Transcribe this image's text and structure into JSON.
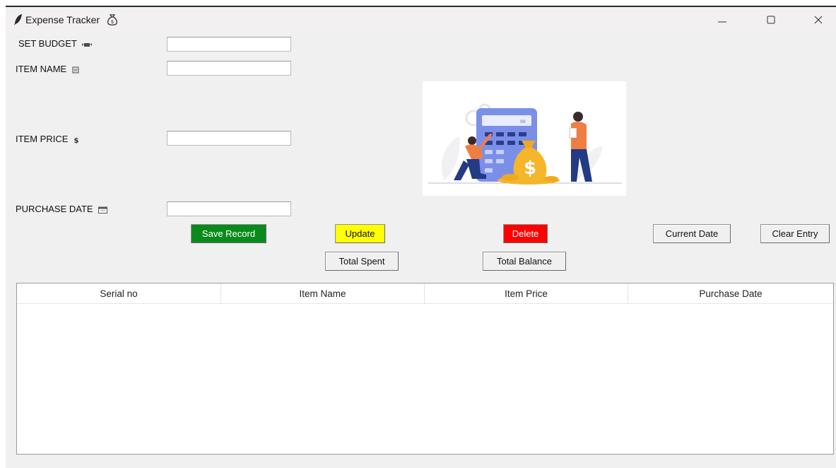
{
  "window": {
    "title": "Expense Tracker",
    "icon": "feather-icon",
    "title_emoji": "money-bag-icon",
    "controls": [
      "minimize-icon",
      "maximize-icon",
      "close-icon"
    ]
  },
  "form": {
    "budget_label": "SET BUDGET",
    "budget_icon": "money-wings-icon",
    "budget_value": "",
    "item_name_label": "ITEM NAME",
    "item_name_icon": "notepad-icon",
    "item_name_value": "",
    "item_price_label": "ITEM PRICE",
    "item_price_icon": "dollar-icon",
    "item_price_value": "",
    "purchase_date_label": "PURCHASE DATE",
    "purchase_date_icon": "calendar-icon",
    "purchase_date_value": ""
  },
  "buttons": {
    "save": "Save Record",
    "update": "Update",
    "delete": "Delete",
    "current_date": "Current Date",
    "clear_entry": "Clear Entry",
    "total_spent": "Total Spent",
    "total_balance": "Total Balance"
  },
  "colors": {
    "save": "#0b8a1c",
    "update": "#ffff00",
    "delete": "#ff0000"
  },
  "illustration": {
    "icon": "budget-calculator-illustration",
    "calculator_display": "99"
  },
  "table": {
    "columns": [
      "Serial no",
      "Item Name",
      "Item Price",
      "Purchase Date"
    ],
    "rows": []
  }
}
